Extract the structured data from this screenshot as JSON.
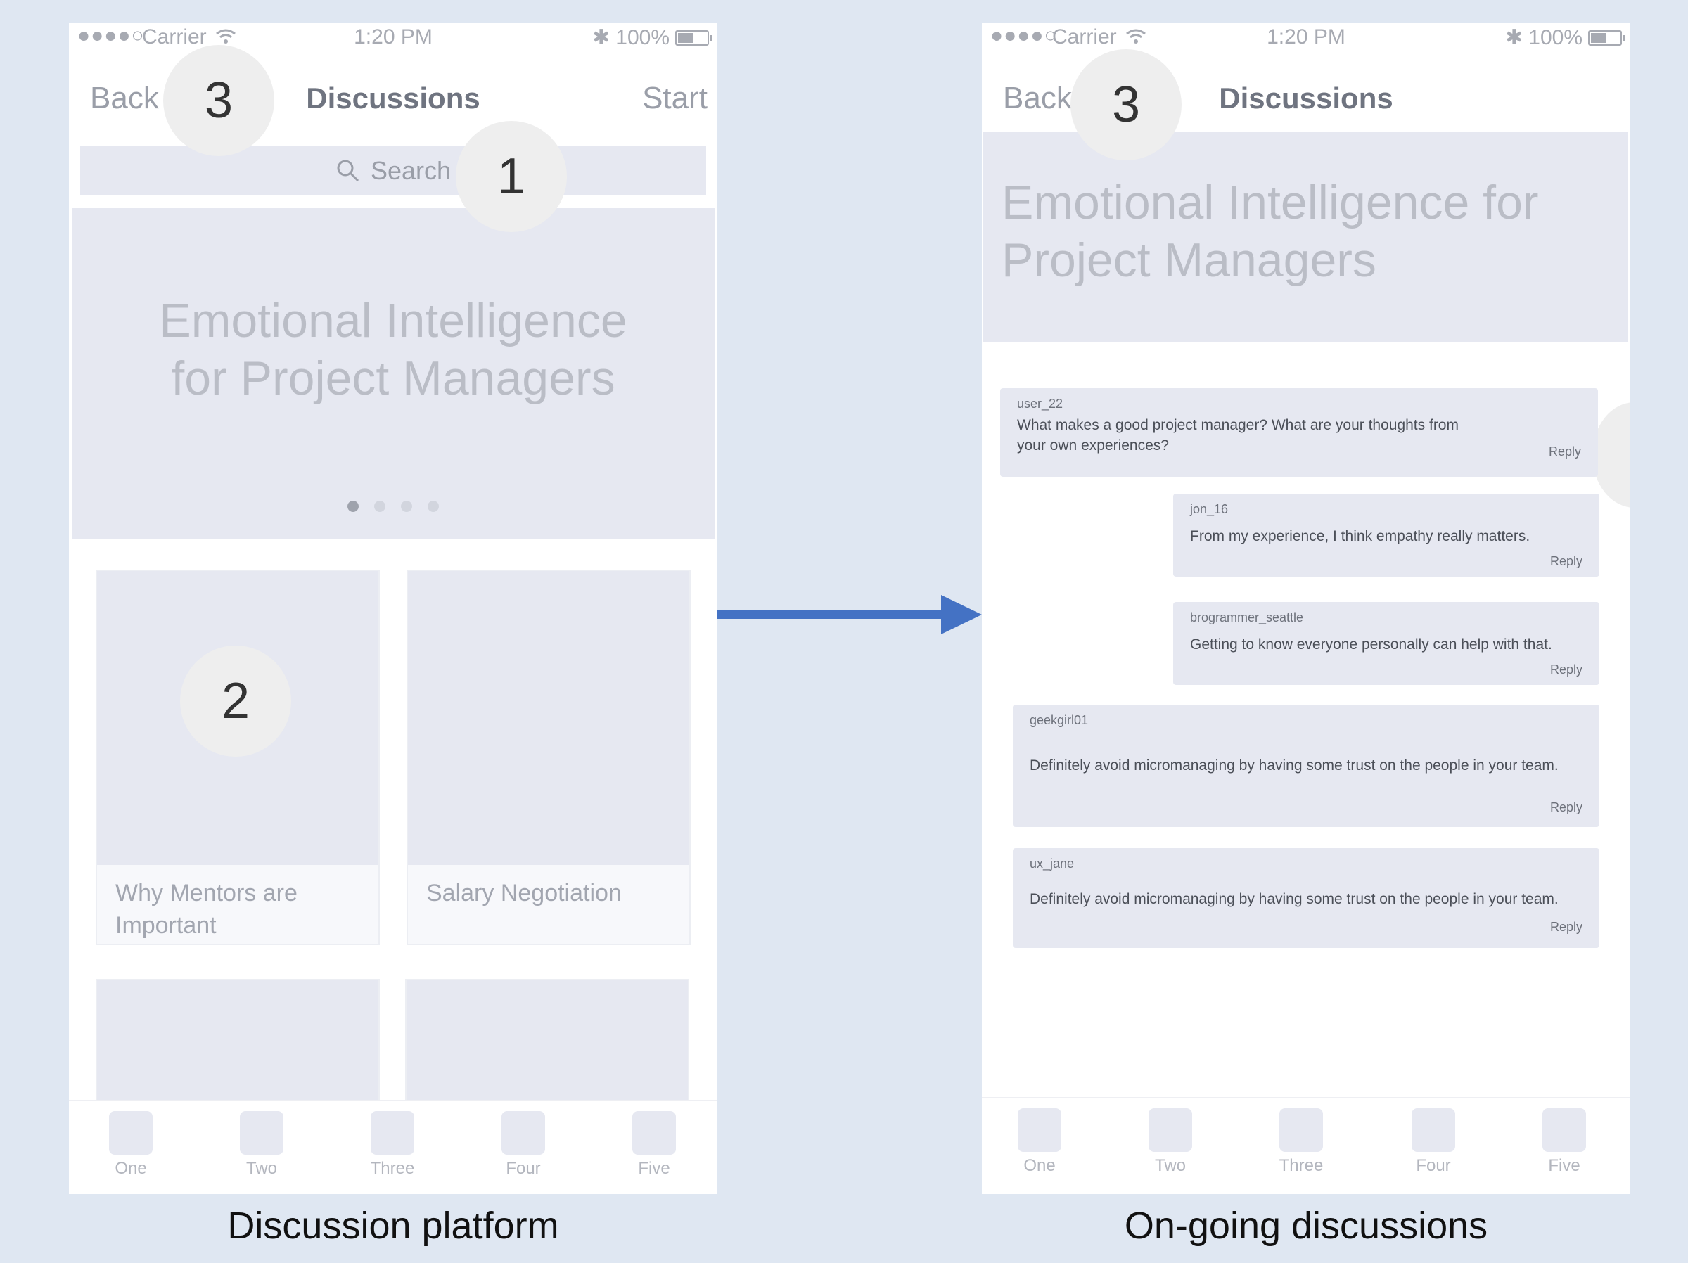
{
  "status": {
    "signal": "●●●●○",
    "carrier": "Carrier",
    "time": "1:20 PM",
    "battery": "100%"
  },
  "left_screen": {
    "back": "Back",
    "title": "Discussions",
    "start": "Start",
    "search_placeholder": "Search",
    "hero_line1": "Emotional Intelligence",
    "hero_line2": "for Project Managers",
    "cards": [
      {
        "line1": "Why Mentors are",
        "line2": "Important"
      },
      {
        "line1": "Salary Negotiation",
        "line2": ""
      }
    ],
    "badges": [
      "3",
      "1",
      "2"
    ]
  },
  "right_screen": {
    "back": "Back",
    "title": "Discussions",
    "hero_line1": "Emotional Intelligence for",
    "hero_line2": "Project Managers",
    "badge": "3",
    "messages": [
      {
        "user": "user_22",
        "text1": "What makes a good project manager? What are your thoughts from",
        "text2": "your own experiences?",
        "reply": "Reply"
      },
      {
        "user": "jon_16",
        "text1": "From my experience, I think empathy really matters.",
        "text2": "",
        "reply": "Reply"
      },
      {
        "user": "brogrammer_seattle",
        "text1": "Getting to know everyone personally can help with that.",
        "text2": "",
        "reply": "Reply"
      },
      {
        "user": "geekgirl01",
        "text1": "Definitely avoid micromanaging by having some trust on the people in your team.",
        "text2": "",
        "reply": "Reply"
      },
      {
        "user": "ux_jane",
        "text1": "Definitely avoid micromanaging by having some trust on the people in your team.",
        "text2": "",
        "reply": "Reply"
      }
    ]
  },
  "tabs": [
    "One",
    "Two",
    "Three",
    "Four",
    "Five"
  ],
  "captions": {
    "left": "Discussion platform",
    "right": "On-going discussions"
  },
  "colors": {
    "background": "#dfe7f2",
    "placeholder_fill": "#e6e8f1",
    "arrow": "#4472c4"
  }
}
